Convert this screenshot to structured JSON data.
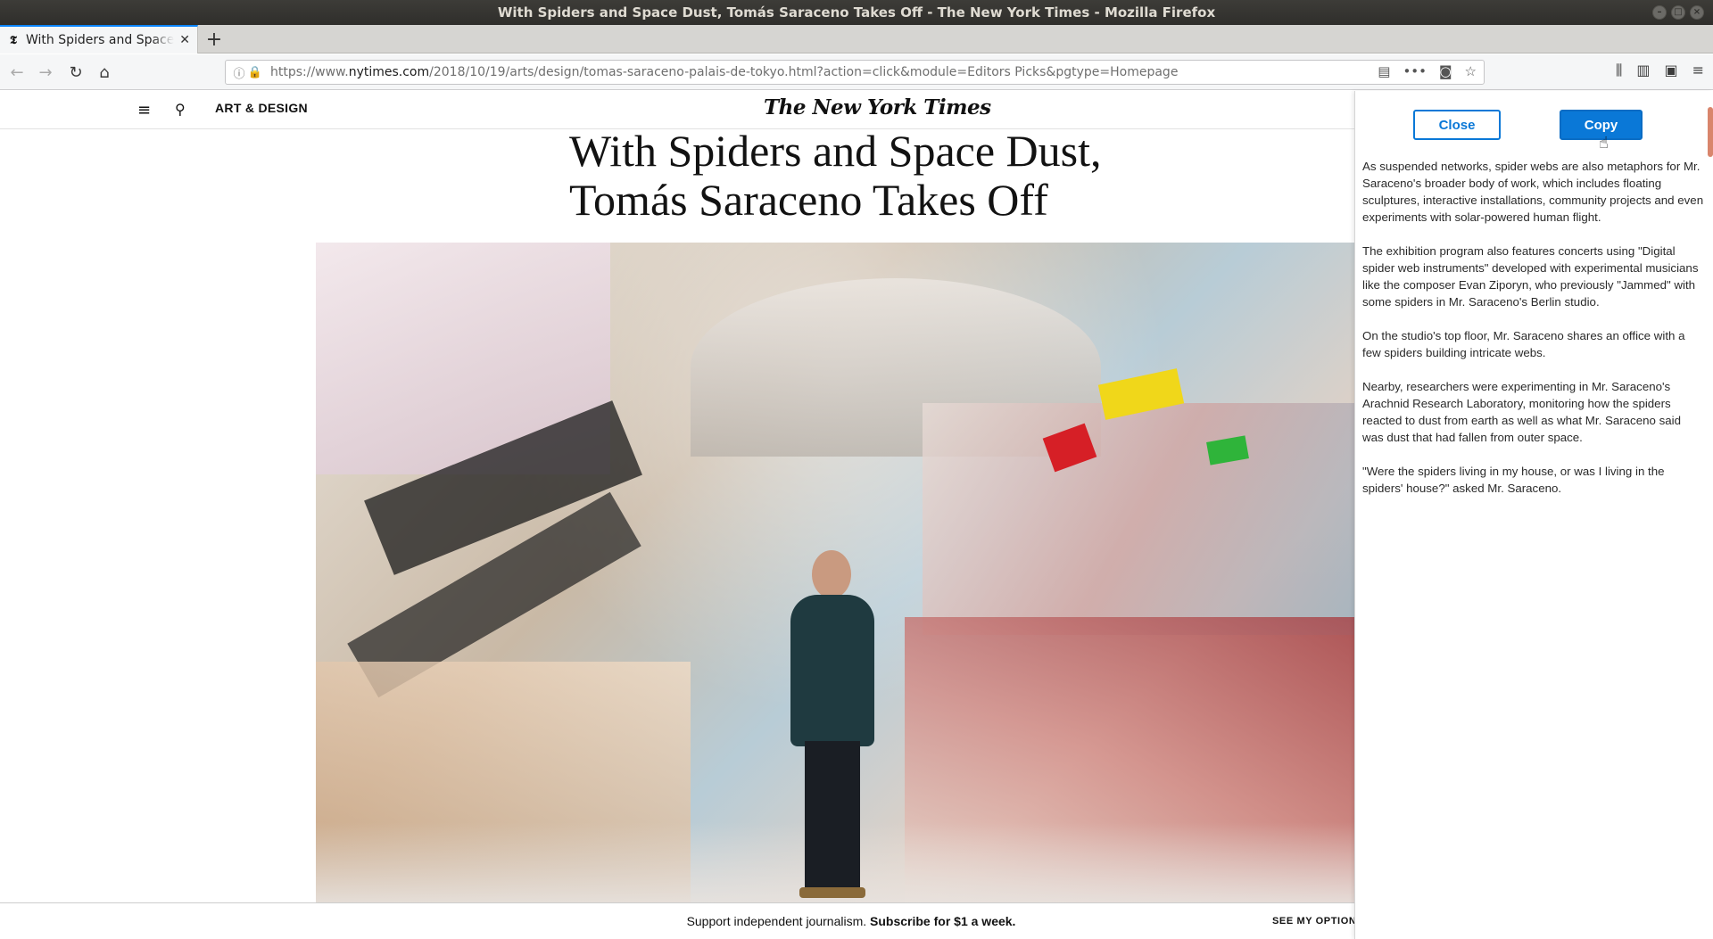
{
  "window": {
    "title": "With Spiders and Space Dust, Tomás Saraceno Takes Off - The New York Times - Mozilla Firefox"
  },
  "tabs": [
    {
      "title": "With Spiders and Space Dust, Tomás Saraceno Takes Off",
      "favicon": "nyt-favicon-icon",
      "active": true
    }
  ],
  "new_tab_label": "+",
  "urlbar": {
    "prefix": "https://www.",
    "host": "nytimes.com",
    "path": "/2018/10/19/arts/design/tomas-saraceno-palais-de-tokyo.html?action=click&module=Editors Picks&pgtype=Homepage"
  },
  "site": {
    "section": "ART & DESIGN",
    "logo": "The New York Times"
  },
  "article": {
    "headline_line1": "With Spiders and Space Dust,",
    "headline_line2": "Tomás Saraceno Takes Off"
  },
  "support_bar": {
    "text": "Support independent journalism.",
    "cta": "Subscribe for $1 a week.",
    "options": "SEE MY OPTIONS"
  },
  "panel": {
    "close_label": "Close",
    "copy_label": "Copy",
    "paragraphs": [
      "As suspended networks, spider webs are also metaphors for Mr. Saraceno's broader body of work, which includes floating sculptures, interactive installations, community projects and even experiments with solar-powered human flight.",
      "The exhibition program also features concerts using \"Digital spider web instruments\" developed with experimental musicians like the composer Evan Ziporyn, who previously \"Jammed\" with some spiders in Mr. Saraceno's Berlin studio.",
      "On the studio's top floor, Mr. Saraceno shares an office with a few spiders building intricate webs.",
      "Nearby, researchers were experimenting in Mr. Saraceno's Arachnid Research Laboratory, monitoring how the spiders reacted to dust from earth as well as what Mr. Saraceno said was dust that had fallen from outer space.",
      "\"Were the spiders living in my house, or was I living in the spiders' house?\" asked Mr. Saraceno."
    ]
  },
  "colors": {
    "accent": "#0a78d7",
    "tab_highlight": "#0a84ff",
    "titlebar": "#2f2e2b"
  }
}
